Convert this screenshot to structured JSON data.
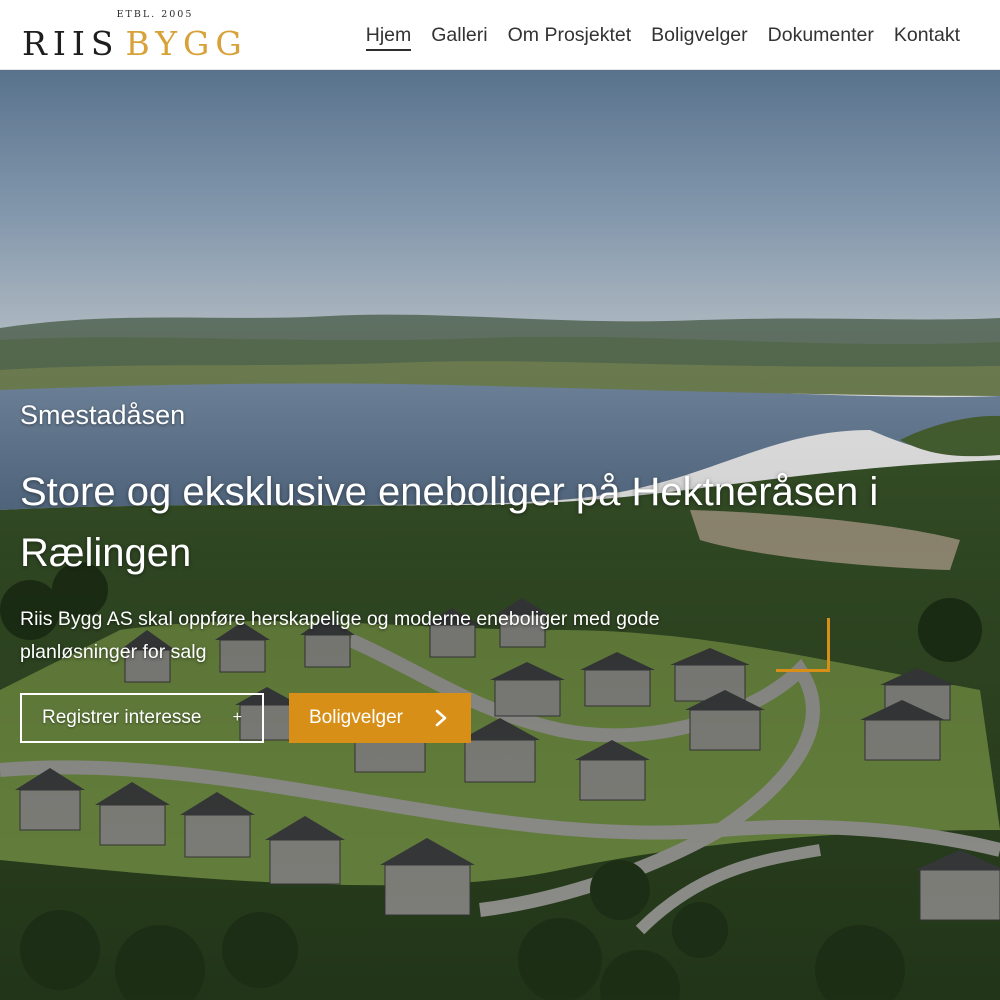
{
  "header": {
    "logo": {
      "established": "ETBL. 2005",
      "word1": "RIIS",
      "word2": "BYGG"
    },
    "nav": [
      {
        "label": "Hjem",
        "active": true
      },
      {
        "label": "Galleri"
      },
      {
        "label": "Om Prosjektet"
      },
      {
        "label": "Boligvelger"
      },
      {
        "label": "Dokumenter"
      },
      {
        "label": "Kontakt"
      }
    ]
  },
  "hero": {
    "eyebrow": "Smestadåsen",
    "headline": "Store og eksklusive eneboliger på Hektneråsen i Rælingen",
    "lead": "Riis Bygg AS skal oppføre herskapelige og moderne eneboliger med gode planløsninger for salg",
    "cta_secondary": {
      "label": "Registrer interesse",
      "icon": "plus-icon"
    },
    "cta_primary": {
      "label": "Boligvelger",
      "icon": "chevron-right-icon"
    }
  },
  "colors": {
    "brand_gold": "#d8a23a",
    "cta_orange": "#d88f17",
    "nav_text": "#333333"
  }
}
